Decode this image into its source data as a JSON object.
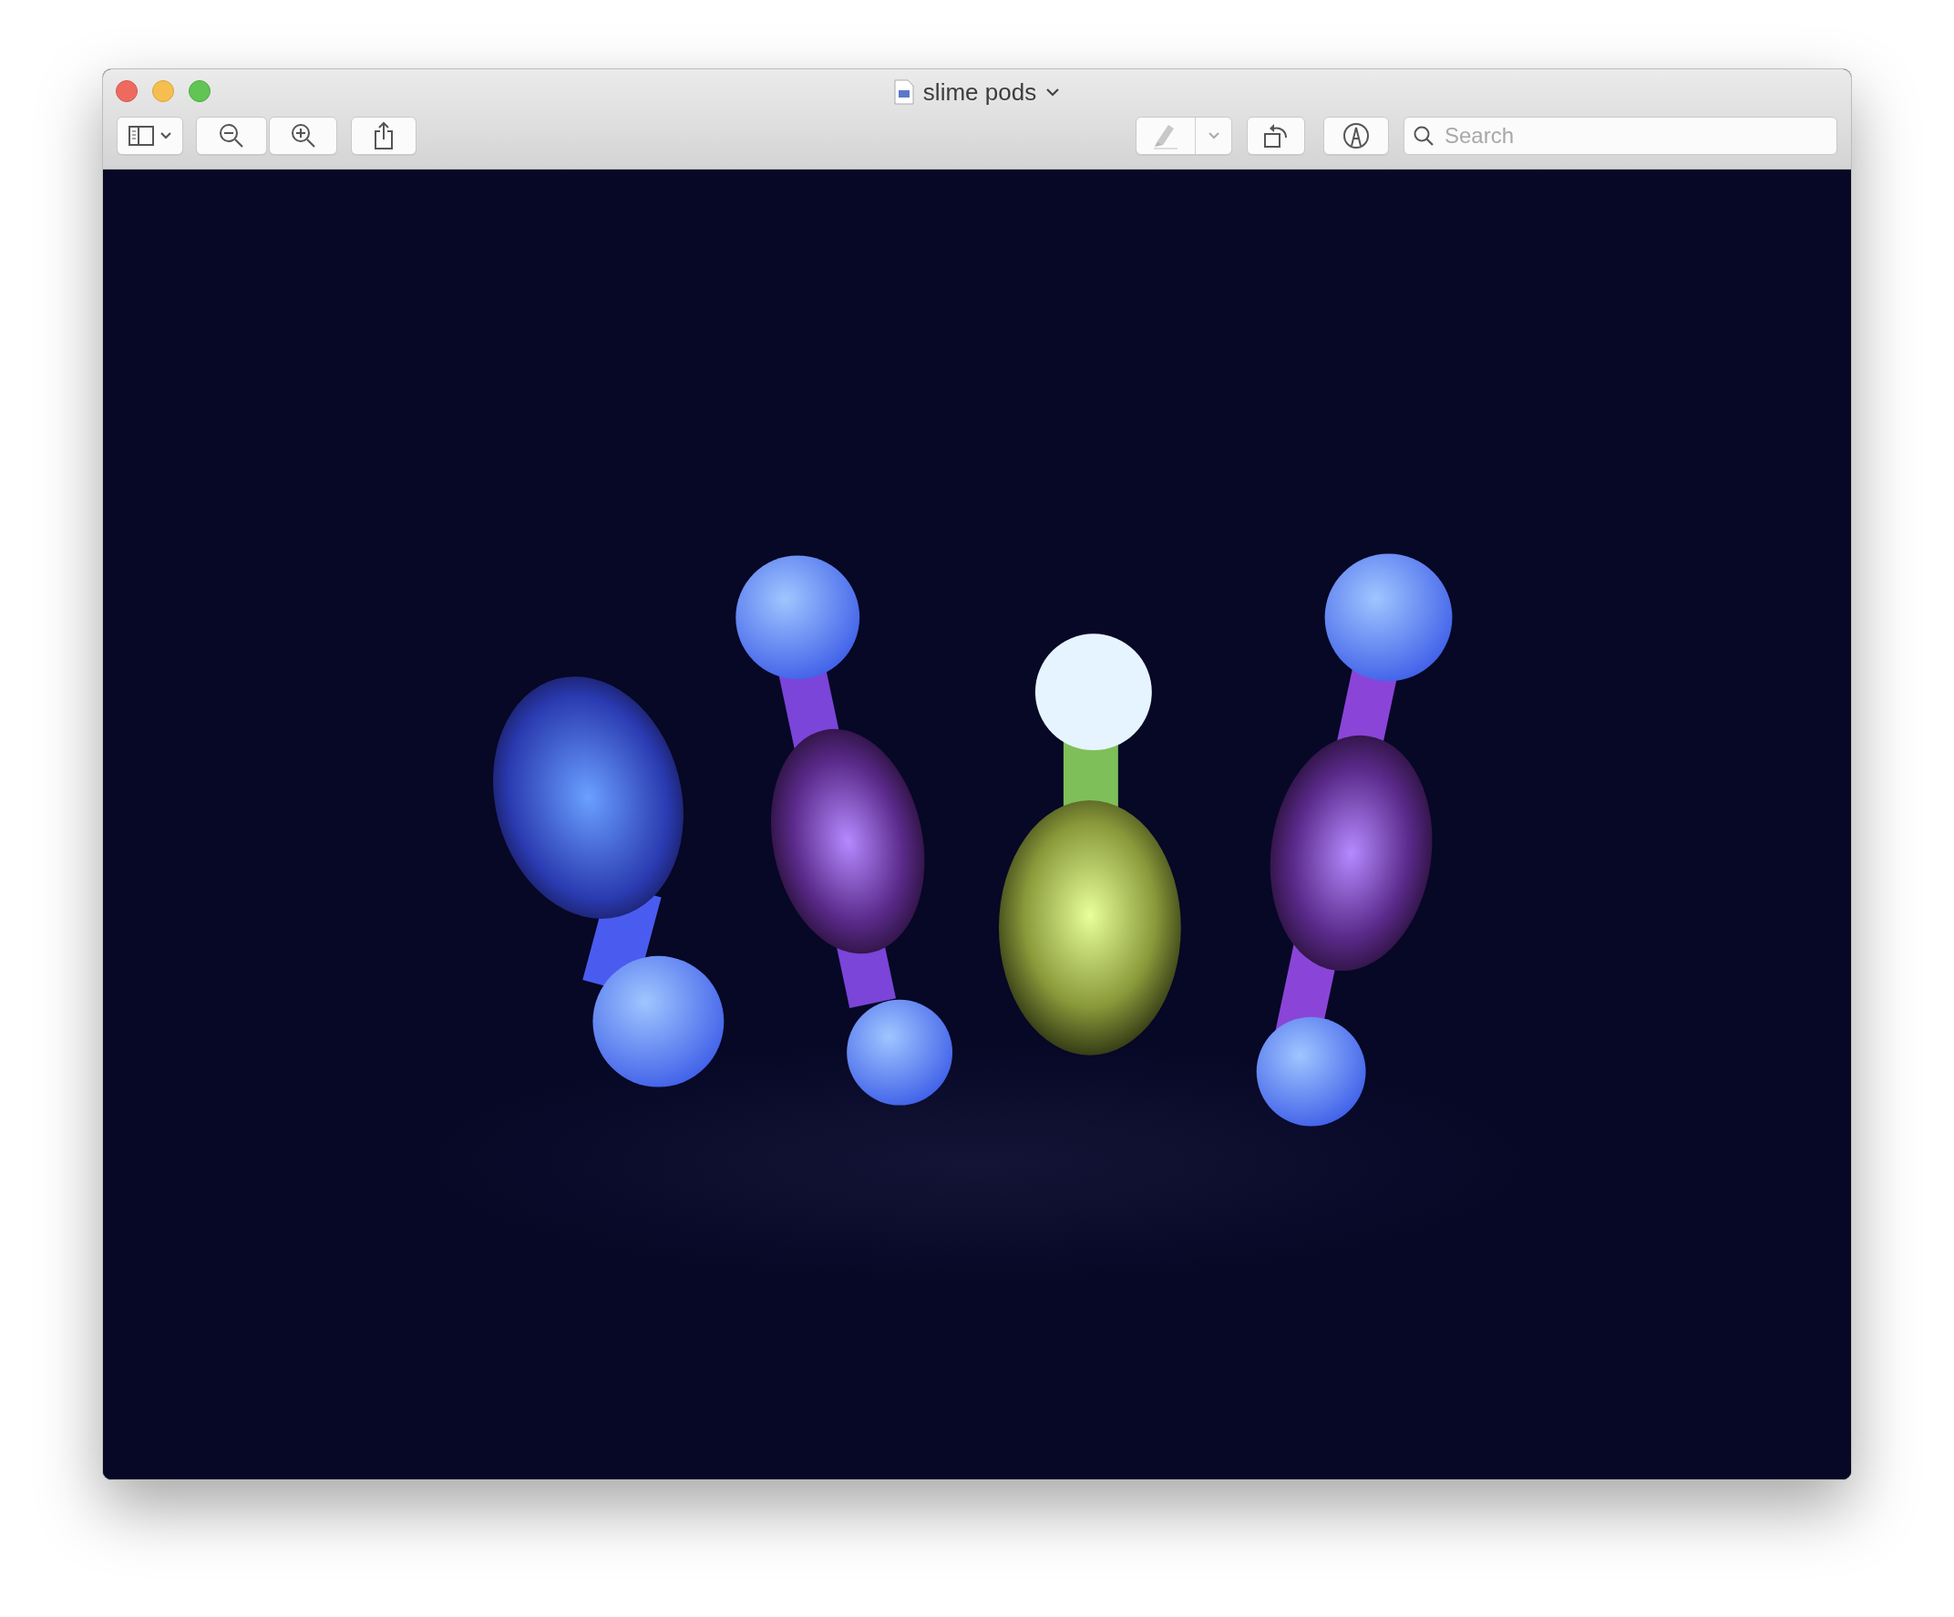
{
  "window": {
    "title": "slime pods"
  },
  "toolbar": {
    "search": {
      "placeholder": "Search"
    }
  }
}
